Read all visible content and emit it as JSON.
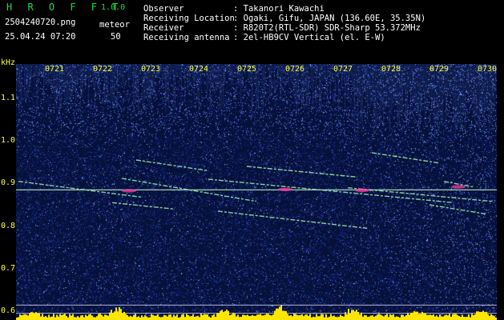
{
  "header": {
    "app_name": "H R O F F T",
    "version": "1.0.0",
    "filename": "2504240720.png",
    "datetime": "25.04.24 07:20",
    "meteor_label": "meteor",
    "meteor_count": "50",
    "info": [
      {
        "label": "Observer",
        "value": ": Takanori Kawachi"
      },
      {
        "label": "Receiving Location",
        "value": ": Ogaki, Gifu, JAPAN (136.60E, 35.35N)"
      },
      {
        "label": "Receiver",
        "value": ": R820T2(RTL-SDR) SDR-Sharp 53.372MHz"
      },
      {
        "label": "Receiving antenna",
        "value": ": 2el-HB9CV Vertical (el. E-W)"
      }
    ]
  },
  "chart_data": {
    "type": "heatmap",
    "ylabel": "kHz",
    "x_tick_labels": [
      "0721",
      "0722",
      "0723",
      "0724",
      "0725",
      "0726",
      "0727",
      "0728",
      "0729",
      "0730"
    ],
    "y_tick_labels": [
      "1.1",
      "1.0",
      "0.9",
      "0.8",
      "0.7",
      "0.6"
    ],
    "x_range_minutes": [
      720,
      730
    ],
    "y_range_khz": [
      0.58,
      1.18
    ],
    "carrier_khz": 0.885,
    "grid": false,
    "colors": {
      "background": "#06113a",
      "noise_low": "#1b2f9a",
      "noise_high": "#9bbcff",
      "trace": "#9ff0b0",
      "trace_hot": "#ff3aa0",
      "carrier": "#c9ffd0",
      "activity": "#ffe600",
      "axis_text": "#ffff33"
    },
    "traces": [
      {
        "t0": 720.05,
        "f0": 0.905,
        "t1": 722.6,
        "f1": 0.868
      },
      {
        "t0": 722.2,
        "f0": 0.912,
        "t1": 725.0,
        "f1": 0.858
      },
      {
        "t0": 722.5,
        "f0": 0.955,
        "t1": 724.0,
        "f1": 0.93
      },
      {
        "t0": 724.0,
        "f0": 0.91,
        "t1": 729.1,
        "f1": 0.855
      },
      {
        "t0": 724.8,
        "f0": 0.94,
        "t1": 727.1,
        "f1": 0.915
      },
      {
        "t0": 724.2,
        "f0": 0.835,
        "t1": 727.3,
        "f1": 0.795
      },
      {
        "t0": 726.9,
        "f0": 0.89,
        "t1": 729.9,
        "f1": 0.858
      },
      {
        "t0": 727.4,
        "f0": 0.972,
        "t1": 728.8,
        "f1": 0.948
      },
      {
        "t0": 728.9,
        "f0": 0.905,
        "t1": 729.5,
        "f1": 0.892
      },
      {
        "t0": 728.6,
        "f0": 0.85,
        "t1": 729.8,
        "f1": 0.828
      },
      {
        "t0": 722.0,
        "f0": 0.855,
        "t1": 723.3,
        "f1": 0.84
      }
    ],
    "hot_spots": [
      {
        "t": 722.35,
        "f": 0.883
      },
      {
        "t": 725.6,
        "f": 0.886
      },
      {
        "t": 727.2,
        "f": 0.884
      },
      {
        "t": 729.2,
        "f": 0.892
      }
    ]
  }
}
